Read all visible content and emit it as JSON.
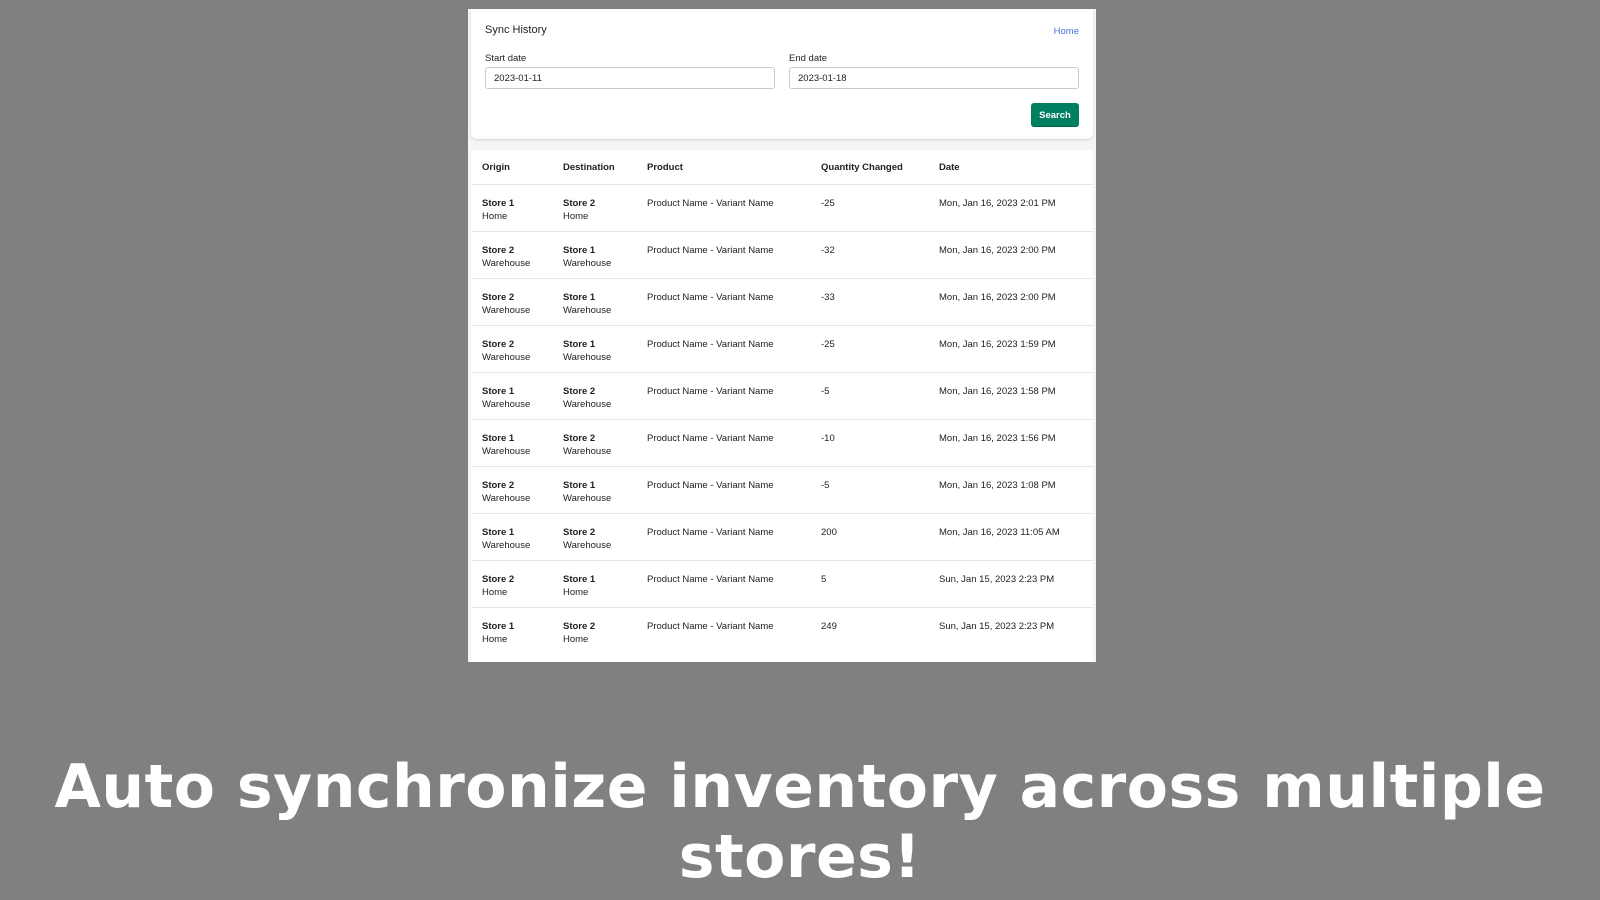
{
  "header": {
    "title": "Sync History",
    "home_link": "Home"
  },
  "filters": {
    "start_date_label": "Start date",
    "start_date_value": "2023-01-11",
    "end_date_label": "End date",
    "end_date_value": "2023-01-18",
    "search_label": "Search"
  },
  "colors": {
    "accent": "#008060",
    "link": "#4a6ee0",
    "backdrop": "#808080"
  },
  "table": {
    "columns": [
      "Origin",
      "Destination",
      "Product",
      "Quantity Changed",
      "Date"
    ],
    "rows": [
      {
        "origin_store": "Store 1",
        "origin_loc": "Home",
        "dest_store": "Store 2",
        "dest_loc": "Home",
        "product": "Product Name - Variant Name",
        "qty": "-25",
        "date": "Mon, Jan 16, 2023 2:01 PM"
      },
      {
        "origin_store": "Store 2",
        "origin_loc": "Warehouse",
        "dest_store": "Store 1",
        "dest_loc": "Warehouse",
        "product": "Product Name - Variant Name",
        "qty": "-32",
        "date": "Mon, Jan 16, 2023 2:00 PM"
      },
      {
        "origin_store": "Store 2",
        "origin_loc": "Warehouse",
        "dest_store": "Store 1",
        "dest_loc": "Warehouse",
        "product": "Product Name - Variant Name",
        "qty": "-33",
        "date": "Mon, Jan 16, 2023 2:00 PM"
      },
      {
        "origin_store": "Store 2",
        "origin_loc": "Warehouse",
        "dest_store": "Store 1",
        "dest_loc": "Warehouse",
        "product": "Product Name - Variant Name",
        "qty": "-25",
        "date": "Mon, Jan 16, 2023 1:59 PM"
      },
      {
        "origin_store": "Store 1",
        "origin_loc": "Warehouse",
        "dest_store": "Store 2",
        "dest_loc": "Warehouse",
        "product": "Product Name - Variant Name",
        "qty": "-5",
        "date": "Mon, Jan 16, 2023 1:58 PM"
      },
      {
        "origin_store": "Store 1",
        "origin_loc": "Warehouse",
        "dest_store": "Store 2",
        "dest_loc": "Warehouse",
        "product": "Product Name - Variant Name",
        "qty": "-10",
        "date": "Mon, Jan 16, 2023 1:56 PM"
      },
      {
        "origin_store": "Store 2",
        "origin_loc": "Warehouse",
        "dest_store": "Store 1",
        "dest_loc": "Warehouse",
        "product": "Product Name - Variant Name",
        "qty": "-5",
        "date": "Mon, Jan 16, 2023 1:08 PM"
      },
      {
        "origin_store": "Store 1",
        "origin_loc": "Warehouse",
        "dest_store": "Store 2",
        "dest_loc": "Warehouse",
        "product": "Product Name - Variant Name",
        "qty": "200",
        "date": "Mon, Jan 16, 2023 11:05 AM"
      },
      {
        "origin_store": "Store 2",
        "origin_loc": "Home",
        "dest_store": "Store 1",
        "dest_loc": "Home",
        "product": "Product Name - Variant Name",
        "qty": "5",
        "date": "Sun, Jan 15, 2023 2:23 PM"
      },
      {
        "origin_store": "Store 1",
        "origin_loc": "Home",
        "dest_store": "Store 2",
        "dest_loc": "Home",
        "product": "Product Name - Variant Name",
        "qty": "249",
        "date": "Sun, Jan 15, 2023 2:23 PM"
      }
    ]
  },
  "caption": "Auto synchronize inventory across multiple stores!"
}
